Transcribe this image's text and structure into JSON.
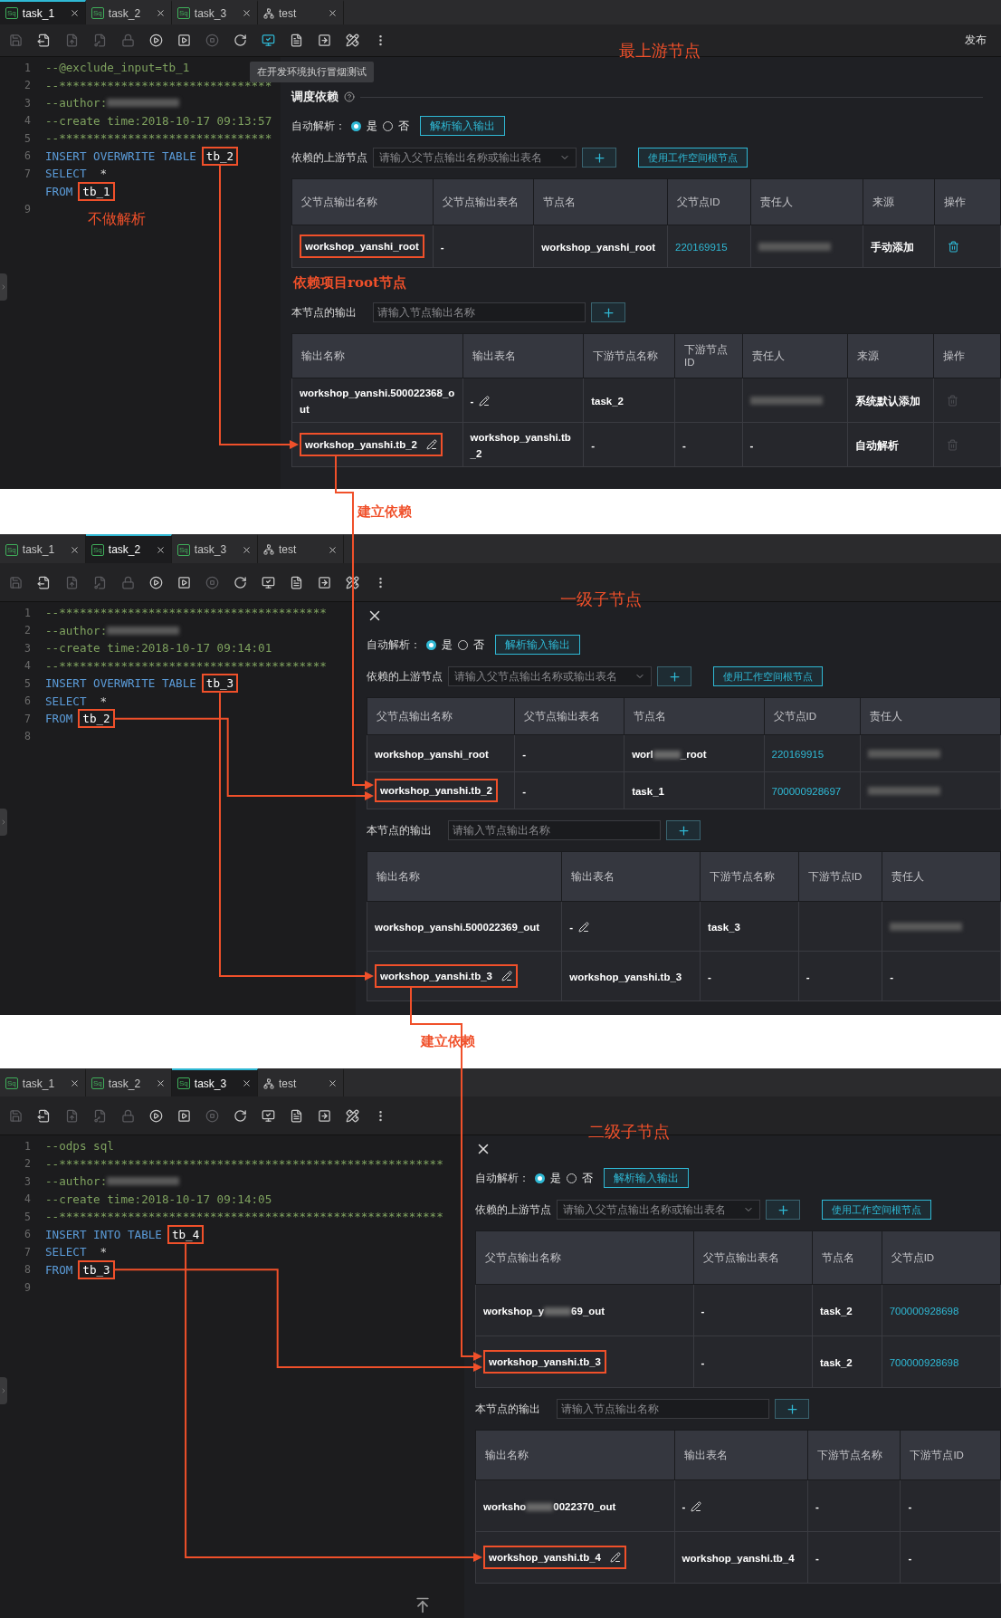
{
  "panels": [
    {
      "tabs": [
        {
          "label": "task_1",
          "kind": "sql",
          "icon_text": "Sq",
          "selected": true
        },
        {
          "label": "task_2",
          "kind": "sql",
          "icon_text": "Sq",
          "selected": false
        },
        {
          "label": "task_3",
          "kind": "sql",
          "icon_text": "Sq",
          "selected": false
        },
        {
          "label": "test",
          "kind": "flow",
          "selected": false
        }
      ],
      "toolbar": [
        {
          "kind": "save",
          "disabled": true,
          "active": false
        },
        {
          "kind": "save-as",
          "disabled": false,
          "active": false
        },
        {
          "kind": "submit",
          "disabled": true,
          "active": false
        },
        {
          "kind": "key",
          "disabled": true,
          "active": false
        },
        {
          "kind": "lock",
          "disabled": true,
          "active": false
        },
        {
          "kind": "run",
          "disabled": false,
          "active": false
        },
        {
          "kind": "run-params",
          "disabled": false,
          "active": false
        },
        {
          "kind": "stop",
          "disabled": true,
          "active": false
        },
        {
          "kind": "reload",
          "disabled": false,
          "active": false
        },
        {
          "kind": "smoke-test",
          "disabled": false,
          "active": true
        },
        {
          "kind": "format",
          "disabled": false,
          "active": false
        },
        {
          "kind": "preview",
          "disabled": false,
          "active": false
        },
        {
          "kind": "tools",
          "disabled": false,
          "active": false
        },
        {
          "kind": "more",
          "disabled": false,
          "active": false
        }
      ],
      "publish": "发布",
      "stage_label": "最上游节点",
      "tooltip": "在开发环境执行冒烟测试",
      "code": [
        {
          "number": "1",
          "tokens": [
            {
              "kind": "comment",
              "text": "--@exclude_input=tb_1"
            }
          ]
        },
        {
          "number": "2",
          "tokens": [
            {
              "kind": "comment",
              "text": "--*******************************"
            }
          ]
        },
        {
          "number": "3",
          "tokens": [
            {
              "kind": "comment",
              "text": "--author:"
            },
            {
              "kind": "redacted"
            }
          ]
        },
        {
          "number": "4",
          "tokens": [
            {
              "kind": "comment",
              "text": "--create time:2018-10-17 09:13:57"
            }
          ]
        },
        {
          "number": "5",
          "tokens": [
            {
              "kind": "comment",
              "text": "--*******************************"
            }
          ]
        },
        {
          "number": "6",
          "tokens": [
            {
              "kind": "keyword",
              "text": "INSERT OVERWRITE TABLE"
            },
            {
              "kind": "box",
              "text": "tb_2"
            }
          ]
        },
        {
          "number": "7",
          "tokens": [
            {
              "kind": "keyword",
              "text": "SELECT"
            },
            {
              "kind": "plain",
              "text": "*"
            }
          ]
        },
        {
          "tokens": [
            {
              "kind": "keyword",
              "text": "FROM"
            },
            {
              "kind": "box",
              "text": "tb_1"
            }
          ]
        },
        {
          "number": "9"
        }
      ],
      "editor_note": "不做解析",
      "section_title": "调度依赖",
      "auto_parse": {
        "label": "自动解析：",
        "options": [
          {
            "label": "是",
            "selected": true
          },
          {
            "label": "否",
            "selected": false
          }
        ],
        "button": "解析输入输出"
      },
      "upstream": {
        "label": "依赖的上游节点",
        "placeholder": "请输入父节点输出名称或输出表名",
        "root_button": "使用工作空间根节点",
        "columns": [
          "父节点输出名称",
          "父节点输出表名",
          "节点名",
          "父节点ID",
          "责任人",
          "来源",
          "操作"
        ],
        "rows": [
          [
            {
              "kind": "text",
              "text": "workshop_yanshi_root",
              "highlight": true
            },
            {
              "kind": "text",
              "text": "-"
            },
            {
              "kind": "text",
              "text": "workshop_yanshi_root"
            },
            {
              "kind": "id",
              "text": "220169915"
            },
            {
              "kind": "redacted"
            },
            {
              "kind": "text",
              "text": "手动添加"
            },
            {
              "kind": "trash",
              "disabled": false
            }
          ]
        ]
      },
      "upstream_note": "依赖项目root节点",
      "output": {
        "label": "本节点的输出",
        "placeholder": "请输入节点输出名称",
        "columns": [
          "输出名称",
          "输出表名",
          "下游节点名称",
          "下游节点ID",
          "责任人",
          "来源",
          "操作"
        ],
        "rows": [
          [
            {
              "kind": "text",
              "text": "workshop_yanshi.500022368_out"
            },
            {
              "kind": "editable",
              "text": "-"
            },
            {
              "kind": "text",
              "text": "task_2"
            },
            {
              "kind": "empty"
            },
            {
              "kind": "redacted"
            },
            {
              "kind": "text",
              "text": "系统默认添加"
            },
            {
              "kind": "trash",
              "disabled": true
            }
          ],
          [
            {
              "kind": "editable",
              "text": "workshop_yanshi.tb_2",
              "highlight": true
            },
            {
              "kind": "text",
              "text": "workshop_yanshi.tb_2"
            },
            {
              "kind": "text",
              "text": "-"
            },
            {
              "kind": "text",
              "text": "-"
            },
            {
              "kind": "text",
              "text": "-"
            },
            {
              "kind": "text",
              "text": "自动解析"
            },
            {
              "kind": "trash",
              "disabled": true
            }
          ]
        ]
      }
    },
    {
      "tabs": [
        {
          "label": "task_1",
          "kind": "sql",
          "icon_text": "Sq",
          "selected": false
        },
        {
          "label": "task_2",
          "kind": "sql",
          "icon_text": "Sq",
          "selected": true
        },
        {
          "label": "task_3",
          "kind": "sql",
          "icon_text": "Sq",
          "selected": false
        },
        {
          "label": "test",
          "kind": "flow",
          "selected": false
        }
      ],
      "toolbar": [
        {
          "kind": "save",
          "disabled": true,
          "active": false
        },
        {
          "kind": "save-as",
          "disabled": false,
          "active": false
        },
        {
          "kind": "submit",
          "disabled": true,
          "active": false
        },
        {
          "kind": "key",
          "disabled": true,
          "active": false
        },
        {
          "kind": "lock",
          "disabled": true,
          "active": false
        },
        {
          "kind": "run",
          "disabled": false,
          "active": false
        },
        {
          "kind": "run-params",
          "disabled": false,
          "active": false
        },
        {
          "kind": "stop",
          "disabled": true,
          "active": false
        },
        {
          "kind": "reload",
          "disabled": false,
          "active": false
        },
        {
          "kind": "smoke-test",
          "disabled": false,
          "active": false
        },
        {
          "kind": "format",
          "disabled": false,
          "active": false
        },
        {
          "kind": "preview",
          "disabled": false,
          "active": false
        },
        {
          "kind": "tools",
          "disabled": false,
          "active": false
        },
        {
          "kind": "more",
          "disabled": false,
          "active": false
        }
      ],
      "stage_label": "一级子节点",
      "closable": true,
      "code": [
        {
          "number": "1",
          "tokens": [
            {
              "kind": "comment",
              "text": "--***************************************"
            }
          ]
        },
        {
          "number": "2",
          "tokens": [
            {
              "kind": "comment",
              "text": "--author:"
            },
            {
              "kind": "redacted"
            }
          ]
        },
        {
          "number": "3",
          "tokens": [
            {
              "kind": "comment",
              "text": "--create time:2018-10-17 09:14:01"
            }
          ]
        },
        {
          "number": "4",
          "tokens": [
            {
              "kind": "comment",
              "text": "--***************************************"
            }
          ]
        },
        {
          "number": "5",
          "tokens": [
            {
              "kind": "keyword",
              "text": "INSERT OVERWRITE TABLE"
            },
            {
              "kind": "box",
              "text": "tb_3"
            }
          ]
        },
        {
          "number": "6",
          "tokens": [
            {
              "kind": "keyword",
              "text": "SELECT"
            },
            {
              "kind": "plain",
              "text": "*"
            }
          ]
        },
        {
          "number": "7",
          "tokens": [
            {
              "kind": "keyword",
              "text": "FROM"
            },
            {
              "kind": "box",
              "text": "tb_2"
            }
          ]
        },
        {
          "number": "8"
        }
      ],
      "auto_parse": {
        "label": "自动解析：",
        "options": [
          {
            "label": "是",
            "selected": true
          },
          {
            "label": "否",
            "selected": false
          }
        ],
        "button": "解析输入输出"
      },
      "upstream": {
        "label": "依赖的上游节点",
        "placeholder": "请输入父节点输出名称或输出表名",
        "root_button": "使用工作空间根节点",
        "columns": [
          "父节点输出名称",
          "父节点输出表名",
          "节点名",
          "父节点ID",
          "责任人"
        ],
        "rows": [
          [
            {
              "kind": "text",
              "text": "workshop_yanshi_root"
            },
            {
              "kind": "text",
              "text": "-"
            },
            {
              "kind": "split",
              "parts": [
                "worl",
                "_root"
              ]
            },
            {
              "kind": "id",
              "text": "220169915"
            },
            {
              "kind": "redacted"
            }
          ],
          [
            {
              "kind": "text",
              "text": "workshop_yanshi.tb_2",
              "highlight": true
            },
            {
              "kind": "text",
              "text": "-"
            },
            {
              "kind": "text",
              "text": "task_1"
            },
            {
              "kind": "id",
              "text": "700000928697"
            },
            {
              "kind": "redacted"
            }
          ]
        ]
      },
      "output": {
        "label": "本节点的输出",
        "placeholder": "请输入节点输出名称",
        "columns": [
          "输出名称",
          "输出表名",
          "下游节点名称",
          "下游节点ID",
          "责任人"
        ],
        "rows": [
          [
            {
              "kind": "text",
              "text": "workshop_yanshi.500022369_out"
            },
            {
              "kind": "editable",
              "text": "-"
            },
            {
              "kind": "text",
              "text": "task_3"
            },
            {
              "kind": "empty"
            },
            {
              "kind": "redacted"
            }
          ],
          [
            {
              "kind": "editable",
              "text": "workshop_yanshi.tb_3",
              "highlight": true
            },
            {
              "kind": "text",
              "text": "workshop_yanshi.tb_3"
            },
            {
              "kind": "text",
              "text": "-"
            },
            {
              "kind": "text",
              "text": "-"
            },
            {
              "kind": "text",
              "text": "-"
            }
          ]
        ]
      }
    },
    {
      "tabs": [
        {
          "label": "task_1",
          "kind": "sql",
          "icon_text": "Sq",
          "selected": false
        },
        {
          "label": "task_2",
          "kind": "sql",
          "icon_text": "Sq",
          "selected": false
        },
        {
          "label": "task_3",
          "kind": "sql",
          "icon_text": "Sq",
          "selected": true
        },
        {
          "label": "test",
          "kind": "flow",
          "selected": false
        }
      ],
      "toolbar": [
        {
          "kind": "save",
          "disabled": true,
          "active": false
        },
        {
          "kind": "save-as",
          "disabled": false,
          "active": false
        },
        {
          "kind": "submit",
          "disabled": true,
          "active": false
        },
        {
          "kind": "key",
          "disabled": true,
          "active": false
        },
        {
          "kind": "lock",
          "disabled": true,
          "active": false
        },
        {
          "kind": "run",
          "disabled": false,
          "active": false
        },
        {
          "kind": "run-params",
          "disabled": false,
          "active": false
        },
        {
          "kind": "stop",
          "disabled": true,
          "active": false
        },
        {
          "kind": "reload",
          "disabled": false,
          "active": false
        },
        {
          "kind": "smoke-test",
          "disabled": false,
          "active": false
        },
        {
          "kind": "format",
          "disabled": false,
          "active": false
        },
        {
          "kind": "preview",
          "disabled": false,
          "active": false
        },
        {
          "kind": "tools",
          "disabled": false,
          "active": false
        },
        {
          "kind": "more",
          "disabled": false,
          "active": false
        }
      ],
      "stage_label": "二级子节点",
      "closable": true,
      "back_to_top": true,
      "code": [
        {
          "number": "1",
          "tokens": [
            {
              "kind": "comment",
              "text": "--odps sql"
            }
          ]
        },
        {
          "number": "2",
          "tokens": [
            {
              "kind": "comment",
              "text": "--********************************************************"
            }
          ]
        },
        {
          "number": "3",
          "tokens": [
            {
              "kind": "comment",
              "text": "--author:"
            },
            {
              "kind": "redacted"
            }
          ]
        },
        {
          "number": "4",
          "tokens": [
            {
              "kind": "comment",
              "text": "--create time:2018-10-17 09:14:05"
            }
          ]
        },
        {
          "number": "5",
          "tokens": [
            {
              "kind": "comment",
              "text": "--********************************************************"
            }
          ]
        },
        {
          "number": "6",
          "tokens": [
            {
              "kind": "keyword",
              "text": "INSERT INTO TABLE"
            },
            {
              "kind": "box",
              "text": "tb_4"
            }
          ]
        },
        {
          "number": "7",
          "tokens": [
            {
              "kind": "keyword",
              "text": "SELECT"
            },
            {
              "kind": "plain",
              "text": "*"
            }
          ]
        },
        {
          "number": "8",
          "tokens": [
            {
              "kind": "keyword",
              "text": "FROM"
            },
            {
              "kind": "box",
              "text": "tb_3"
            }
          ]
        },
        {
          "number": "9"
        }
      ],
      "auto_parse": {
        "label": "自动解析：",
        "options": [
          {
            "label": "是",
            "selected": true
          },
          {
            "label": "否",
            "selected": false
          }
        ],
        "button": "解析输入输出"
      },
      "upstream": {
        "label": "依赖的上游节点",
        "placeholder": "请输入父节点输出名称或输出表名",
        "root_button": "使用工作空间根节点",
        "columns": [
          "父节点输出名称",
          "父节点输出表名",
          "节点名",
          "父节点ID"
        ],
        "rows": [
          [
            {
              "kind": "split",
              "parts": [
                "workshop_y",
                "69_out"
              ]
            },
            {
              "kind": "text",
              "text": "-"
            },
            {
              "kind": "text",
              "text": "task_2"
            },
            {
              "kind": "id",
              "text": "700000928698"
            }
          ],
          [
            {
              "kind": "text",
              "text": "workshop_yanshi.tb_3",
              "highlight": true
            },
            {
              "kind": "text",
              "text": "-"
            },
            {
              "kind": "text",
              "text": "task_2"
            },
            {
              "kind": "id",
              "text": "700000928698"
            }
          ]
        ]
      },
      "output": {
        "label": "本节点的输出",
        "placeholder": "请输入节点输出名称",
        "columns": [
          "输出名称",
          "输出表名",
          "下游节点名称",
          "下游节点ID"
        ],
        "rows": [
          [
            {
              "kind": "split",
              "parts": [
                "worksho",
                "0022370_out"
              ]
            },
            {
              "kind": "editable",
              "text": "-"
            },
            {
              "kind": "text",
              "text": "-"
            },
            {
              "kind": "text",
              "text": "-"
            }
          ],
          [
            {
              "kind": "editable",
              "text": "workshop_yanshi.tb_4",
              "highlight": true
            },
            {
              "kind": "text",
              "text": "workshop_yanshi.tb_4"
            },
            {
              "kind": "text",
              "text": "-"
            },
            {
              "kind": "text",
              "text": "-"
            }
          ]
        ]
      }
    }
  ],
  "links": [
    {
      "label": "建立依赖"
    },
    {
      "label": "建立依赖"
    }
  ]
}
